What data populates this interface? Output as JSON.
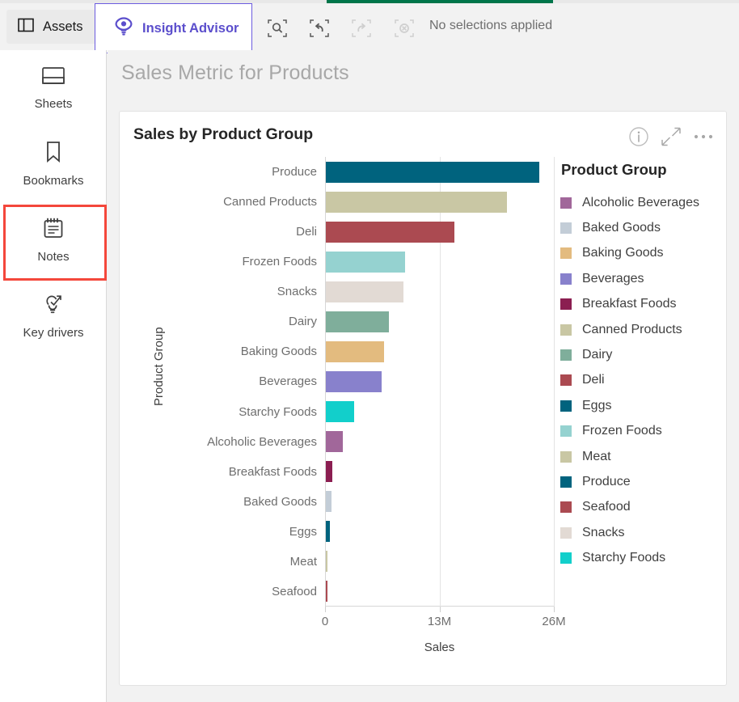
{
  "progress": {
    "percent": 31,
    "color": "#00754a"
  },
  "header": {
    "assets_label": "Assets",
    "assets_icon": "panel-layout-icon",
    "insight_advisor_label": "Insight Advisor",
    "insight_advisor_icon": "insight-advisor-eye-icon",
    "selection_search_icon": "selection-search-icon",
    "step_back_icon": "step-back-icon",
    "step_forward_icon": "step-forward-icon",
    "clear_selections_icon": "clear-selections-icon",
    "selection_status": "No selections applied",
    "accent_color": "#5b4ecc"
  },
  "sidebar": {
    "items": [
      {
        "label": "Sheets",
        "icon": "sheets-icon",
        "highlighted": false
      },
      {
        "label": "Bookmarks",
        "icon": "bookmark-icon",
        "highlighted": false
      },
      {
        "label": "Notes",
        "icon": "notes-icon",
        "highlighted": true
      },
      {
        "label": "Key drivers",
        "icon": "key-drivers-icon",
        "highlighted": false
      }
    ],
    "highlight_color": "#f4473b"
  },
  "main": {
    "page_title": "Sales Metric for Products",
    "card": {
      "title": "Sales by Product Group",
      "actions": [
        {
          "name": "info-icon",
          "label": "i"
        },
        {
          "name": "fullscreen-icon",
          "label": ""
        },
        {
          "name": "more-options-icon",
          "label": "…"
        }
      ]
    }
  },
  "chart_data": {
    "type": "bar",
    "orientation": "horizontal",
    "title": "Sales by Product Group",
    "xlabel": "Sales",
    "ylabel": "Product Group",
    "xlim": [
      0,
      26000000
    ],
    "xticks": [
      0,
      13000000,
      26000000
    ],
    "xtick_labels": [
      "0",
      "13M",
      "26M"
    ],
    "grid": true,
    "legend_position": "right",
    "legend_title": "Product Group",
    "categories": [
      "Produce",
      "Canned Products",
      "Deli",
      "Frozen Foods",
      "Snacks",
      "Dairy",
      "Baking Goods",
      "Beverages",
      "Starchy Foods",
      "Alcoholic Beverages",
      "Breakfast Foods",
      "Baked Goods",
      "Eggs",
      "Meat",
      "Seafood"
    ],
    "values": [
      24300000,
      20600000,
      14600000,
      9000000,
      8800000,
      7200000,
      6600000,
      6300000,
      3200000,
      1900000,
      700000,
      600000,
      500000,
      150000,
      120000
    ],
    "bar_colors": [
      "#00637e",
      "#c9c7a4",
      "#ab4a51",
      "#95d2d0",
      "#e2dad4",
      "#7fae9b",
      "#e3bb7f",
      "#8881cc",
      "#12cfcb",
      "#a1679a",
      "#8b1e51",
      "#c3cdd7",
      "#00637e",
      "#c9c7a4",
      "#ab4a51"
    ],
    "legend_entries": [
      {
        "label": "Alcoholic Beverages",
        "color": "#a1679a"
      },
      {
        "label": "Baked Goods",
        "color": "#c3cdd7"
      },
      {
        "label": "Baking Goods",
        "color": "#e3bb7f"
      },
      {
        "label": "Beverages",
        "color": "#8881cc"
      },
      {
        "label": "Breakfast Foods",
        "color": "#8b1e51"
      },
      {
        "label": "Canned Products",
        "color": "#c9c7a4"
      },
      {
        "label": "Dairy",
        "color": "#7fae9b"
      },
      {
        "label": "Deli",
        "color": "#ab4a51"
      },
      {
        "label": "Eggs",
        "color": "#00637e"
      },
      {
        "label": "Frozen Foods",
        "color": "#95d2d0"
      },
      {
        "label": "Meat",
        "color": "#c9c7a4"
      },
      {
        "label": "Produce",
        "color": "#00637e"
      },
      {
        "label": "Seafood",
        "color": "#ab4a51"
      },
      {
        "label": "Snacks",
        "color": "#e2dad4"
      },
      {
        "label": "Starchy Foods",
        "color": "#12cfcb"
      }
    ]
  }
}
